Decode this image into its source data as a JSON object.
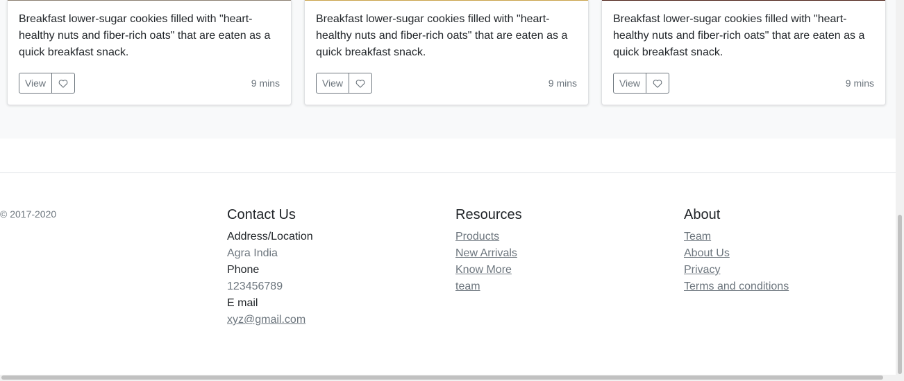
{
  "cards": [
    {
      "text": "Breakfast lower-sugar cookies filled with \"heart-healthy nuts and fiber-rich oats\" that are eaten as a quick breakfast snack.",
      "view_label": "View",
      "time": "9 mins"
    },
    {
      "text": "Breakfast lower-sugar cookies filled with \"heart-healthy nuts and fiber-rich oats\" that are eaten as a quick breakfast snack.",
      "view_label": "View",
      "time": "9 mins"
    },
    {
      "text": "Breakfast lower-sugar cookies filled with \"heart-healthy nuts and fiber-rich oats\" that are eaten as a quick breakfast snack.",
      "view_label": "View",
      "time": "9 mins"
    }
  ],
  "footer": {
    "copyright": "© 2017-2020",
    "contact": {
      "title": "Contact Us",
      "address_label": "Address/Location",
      "address_value": "Agra India",
      "phone_label": "Phone",
      "phone_value": "123456789",
      "email_label": "E mail",
      "email_value": "xyz@gmail.com"
    },
    "resources": {
      "title": "Resources",
      "links": [
        "Products",
        "New Arrivals",
        "Know More",
        "team"
      ]
    },
    "about": {
      "title": "About",
      "links": [
        "Team",
        "About Us",
        "Privacy",
        "Terms and conditions"
      ]
    }
  },
  "colors": {
    "band_background": "#f8f9fa",
    "muted_text": "#6c757d",
    "card_image_strips": [
      "#8a7f70",
      "#c9a24a",
      "#4a1d12"
    ]
  },
  "icons": {
    "like": "heart-outline-icon"
  }
}
